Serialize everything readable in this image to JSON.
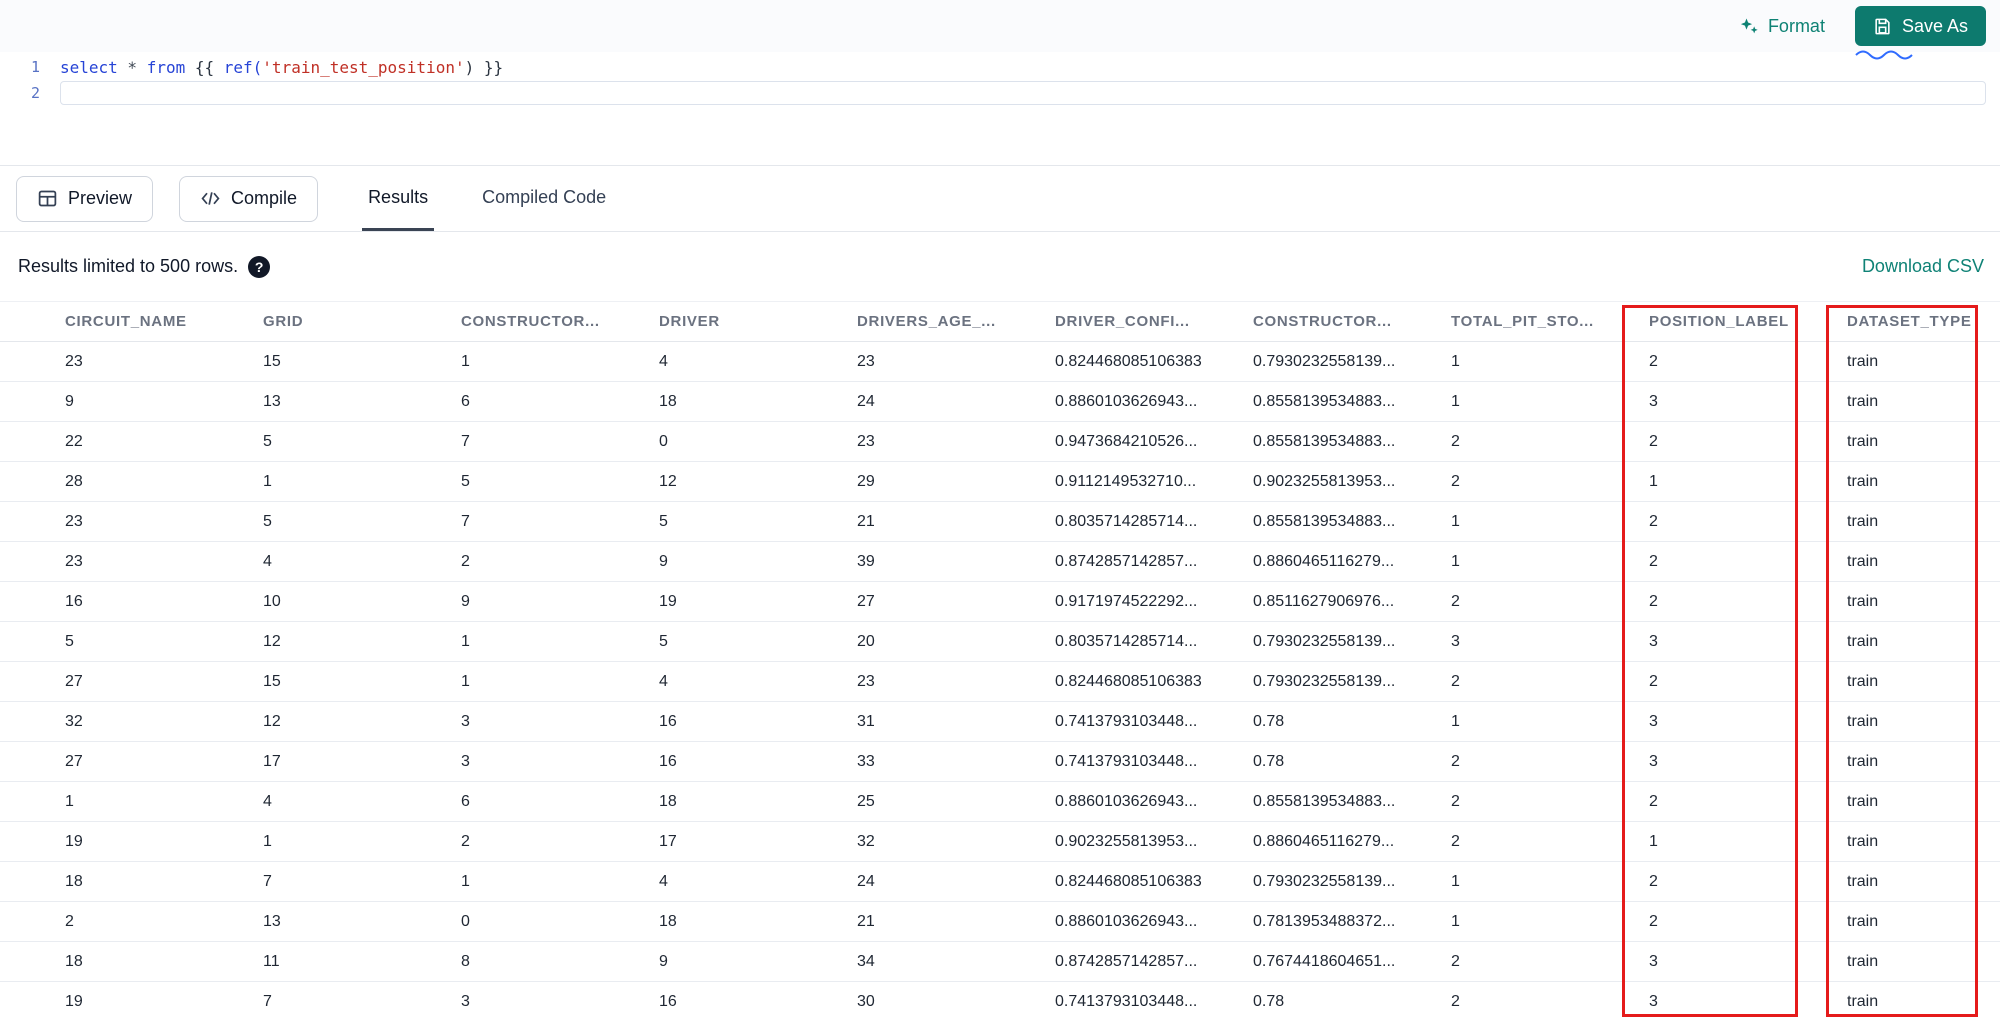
{
  "toolbar": {
    "format_label": "Format",
    "save_as_label": "Save As",
    "accent_color": "#0e8274",
    "save_button_color": "#0d7a6e"
  },
  "editor": {
    "lines": [
      {
        "number": "1",
        "boxed": false,
        "tokens": [
          {
            "type": "kw",
            "text": "select"
          },
          {
            "type": "op",
            "text": " * "
          },
          {
            "type": "kw",
            "text": "from"
          },
          {
            "type": "plain",
            "text": " {{ "
          },
          {
            "type": "kw",
            "text": "ref("
          },
          {
            "type": "str",
            "text": "'train_test_position'"
          },
          {
            "type": "plain",
            "text": ") }}"
          }
        ]
      },
      {
        "number": "2",
        "boxed": true,
        "tokens": []
      }
    ]
  },
  "actions": {
    "preview_label": "Preview",
    "compile_label": "Compile"
  },
  "tabs": {
    "items": [
      {
        "label": "Results",
        "active": true
      },
      {
        "label": "Compiled Code",
        "active": false
      }
    ]
  },
  "results_bar": {
    "limit_text": "Results limited to 500 rows.",
    "help_glyph": "?",
    "download_label": "Download CSV"
  },
  "table": {
    "columns": [
      "CIRCUIT_NAME",
      "GRID",
      "CONSTRUCTOR...",
      "DRIVER",
      "DRIVERS_AGE_...",
      "DRIVER_CONFI...",
      "CONSTRUCTOR...",
      "TOTAL_PIT_STO...",
      "POSITION_LABEL",
      "DATASET_TYPE"
    ],
    "rows": [
      [
        "23",
        "15",
        "1",
        "4",
        "23",
        "0.824468085106383",
        "0.7930232558139...",
        "1",
        "2",
        "train"
      ],
      [
        "9",
        "13",
        "6",
        "18",
        "24",
        "0.8860103626943...",
        "0.8558139534883...",
        "1",
        "3",
        "train"
      ],
      [
        "22",
        "5",
        "7",
        "0",
        "23",
        "0.9473684210526...",
        "0.8558139534883...",
        "2",
        "2",
        "train"
      ],
      [
        "28",
        "1",
        "5",
        "12",
        "29",
        "0.9112149532710...",
        "0.9023255813953...",
        "2",
        "1",
        "train"
      ],
      [
        "23",
        "5",
        "7",
        "5",
        "21",
        "0.8035714285714...",
        "0.8558139534883...",
        "1",
        "2",
        "train"
      ],
      [
        "23",
        "4",
        "2",
        "9",
        "39",
        "0.8742857142857...",
        "0.8860465116279...",
        "1",
        "2",
        "train"
      ],
      [
        "16",
        "10",
        "9",
        "19",
        "27",
        "0.9171974522292...",
        "0.8511627906976...",
        "2",
        "2",
        "train"
      ],
      [
        "5",
        "12",
        "1",
        "5",
        "20",
        "0.8035714285714...",
        "0.7930232558139...",
        "3",
        "3",
        "train"
      ],
      [
        "27",
        "15",
        "1",
        "4",
        "23",
        "0.824468085106383",
        "0.7930232558139...",
        "2",
        "2",
        "train"
      ],
      [
        "32",
        "12",
        "3",
        "16",
        "31",
        "0.7413793103448...",
        "0.78",
        "1",
        "3",
        "train"
      ],
      [
        "27",
        "17",
        "3",
        "16",
        "33",
        "0.7413793103448...",
        "0.78",
        "2",
        "3",
        "train"
      ],
      [
        "1",
        "4",
        "6",
        "18",
        "25",
        "0.8860103626943...",
        "0.8558139534883...",
        "2",
        "2",
        "train"
      ],
      [
        "19",
        "1",
        "2",
        "17",
        "32",
        "0.9023255813953...",
        "0.8860465116279...",
        "2",
        "1",
        "train"
      ],
      [
        "18",
        "7",
        "1",
        "4",
        "24",
        "0.824468085106383",
        "0.7930232558139...",
        "1",
        "2",
        "train"
      ],
      [
        "2",
        "13",
        "0",
        "18",
        "21",
        "0.8860103626943...",
        "0.7813953488372...",
        "1",
        "2",
        "train"
      ],
      [
        "18",
        "11",
        "8",
        "9",
        "34",
        "0.8742857142857...",
        "0.7674418604651...",
        "2",
        "3",
        "train"
      ],
      [
        "19",
        "7",
        "3",
        "16",
        "30",
        "0.7413793103448...",
        "0.78",
        "2",
        "3",
        "train"
      ]
    ]
  },
  "annotations": {
    "color": "#e51b1b",
    "highlighted_columns": [
      "POSITION_LABEL",
      "DATASET_TYPE"
    ]
  }
}
